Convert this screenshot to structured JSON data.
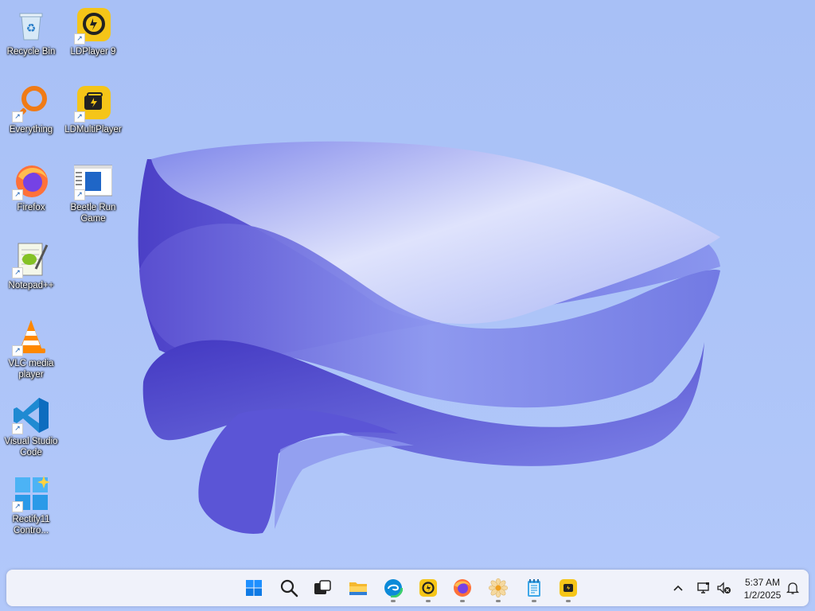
{
  "desktop": {
    "icons": [
      {
        "label": "Recycle Bin",
        "icon": "recycle-bin-icon"
      },
      {
        "label": "LDPlayer 9",
        "icon": "ldplayer-icon"
      },
      {
        "label": "Everything",
        "icon": "everything-search-icon"
      },
      {
        "label": "LDMultiPlayer",
        "icon": "ldmultiplayer-icon"
      },
      {
        "label": "Firefox",
        "icon": "firefox-icon"
      },
      {
        "label": "Beetle Run Game",
        "icon": "beetle-run-game-icon"
      },
      {
        "label": "Notepad++",
        "icon": "notepadpp-icon"
      },
      {
        "label": "VLC media player",
        "icon": "vlc-icon"
      },
      {
        "label": "Visual Studio Code",
        "icon": "vscode-icon"
      },
      {
        "label": "Rectify11 Contro...",
        "icon": "rectify11-icon"
      }
    ]
  },
  "taskbar": {
    "apps": [
      {
        "name": "Start",
        "icon": "windows-start-icon"
      },
      {
        "name": "Search",
        "icon": "search-icon"
      },
      {
        "name": "Task View",
        "icon": "task-view-icon"
      },
      {
        "name": "File Explorer",
        "icon": "file-explorer-icon"
      },
      {
        "name": "Microsoft Edge",
        "icon": "edge-icon"
      },
      {
        "name": "LDPlayer 9",
        "icon": "ldplayer-icon"
      },
      {
        "name": "Firefox",
        "icon": "firefox-icon"
      },
      {
        "name": "Rectify11",
        "icon": "flower-icon"
      },
      {
        "name": "Notepad",
        "icon": "notepad-icon"
      },
      {
        "name": "LDMultiPlayer",
        "icon": "ldmultiplayer-icon"
      }
    ],
    "tray": {
      "time": "5:37 AM",
      "date": "1/2/2025"
    }
  },
  "colors": {
    "wallpaper": "#a9c2f7",
    "bloom_dark": "#4a43c8",
    "bloom_light": "#d6dcfb"
  }
}
